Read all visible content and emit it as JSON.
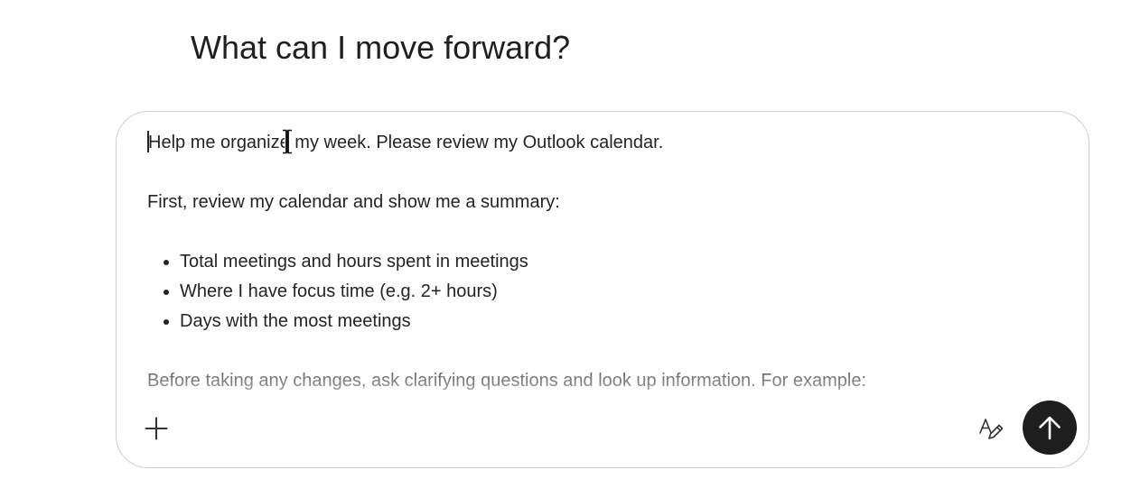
{
  "heading": "What can I move forward?",
  "composer": {
    "line1": "Help me organize my week. Please review my Outlook calendar.",
    "line2": "First, review my calendar and show me a summary:",
    "bullets": [
      "Total meetings and hours spent in meetings",
      "Where I have focus time (e.g. 2+ hours)",
      "Days with the most meetings"
    ],
    "line3": "Before taking any changes, ask clarifying questions and look up information. For example:"
  },
  "icons": {
    "add": "plus-icon",
    "style": "text-style-pen-icon",
    "send": "arrow-up-icon"
  },
  "colors": {
    "send_button": "#1e1e1e",
    "border": "#cfcfcf",
    "text": "#242424"
  }
}
